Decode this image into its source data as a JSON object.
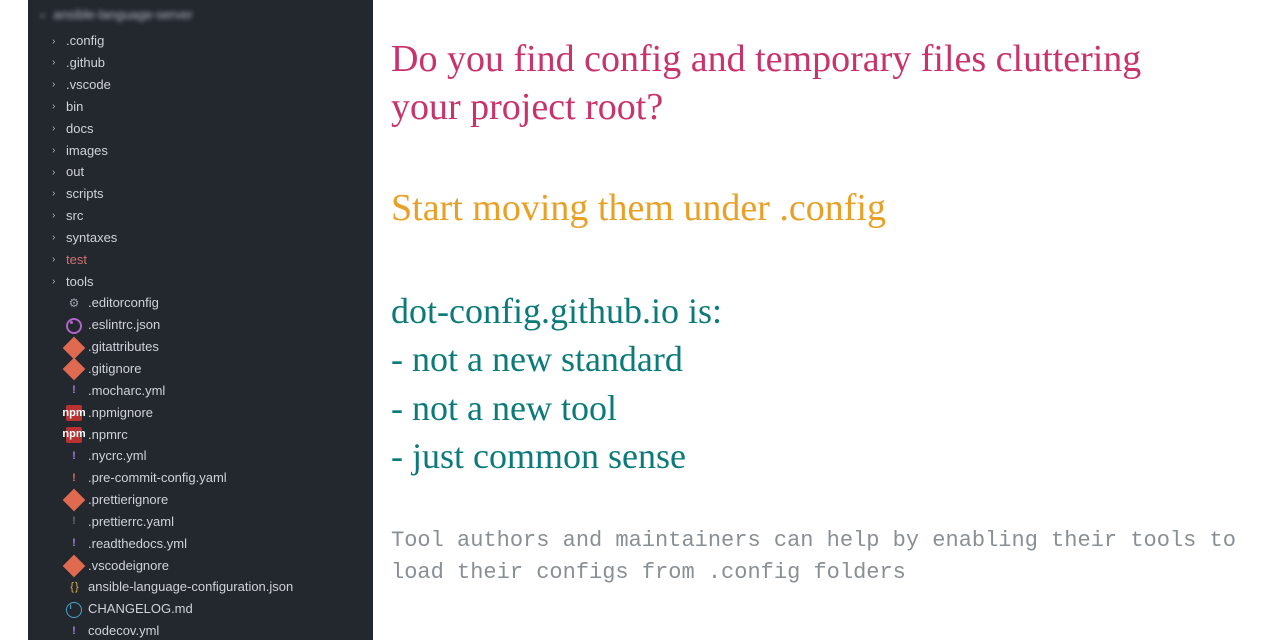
{
  "sidebar": {
    "root_label": "ansible-language-server",
    "folders": [
      {
        "name": ".config"
      },
      {
        "name": ".github"
      },
      {
        "name": ".vscode"
      },
      {
        "name": "bin"
      },
      {
        "name": "docs"
      },
      {
        "name": "images"
      },
      {
        "name": "out"
      },
      {
        "name": "scripts"
      },
      {
        "name": "src"
      },
      {
        "name": "syntaxes"
      },
      {
        "name": "test",
        "accent": true
      },
      {
        "name": "tools"
      }
    ],
    "files": [
      {
        "name": ".editorconfig",
        "icon": "ic-gear"
      },
      {
        "name": ".eslintrc.json",
        "icon": "ic-target"
      },
      {
        "name": ".gitattributes",
        "icon": "ic-diamond"
      },
      {
        "name": ".gitignore",
        "icon": "ic-diamond"
      },
      {
        "name": ".mocharc.yml",
        "icon": "ic-bang purple"
      },
      {
        "name": ".npmignore",
        "icon": "ic-npm"
      },
      {
        "name": ".npmrc",
        "icon": "ic-npm"
      },
      {
        "name": ".nycrc.yml",
        "icon": "ic-bang purple"
      },
      {
        "name": ".pre-commit-config.yaml",
        "icon": "ic-bang red"
      },
      {
        "name": ".prettierignore",
        "icon": "ic-diamond"
      },
      {
        "name": ".prettierrc.yaml",
        "icon": "ic-bang dark"
      },
      {
        "name": ".readthedocs.yml",
        "icon": "ic-bang purple"
      },
      {
        "name": ".vscodeignore",
        "icon": "ic-diamond"
      },
      {
        "name": "ansible-language-configuration.json",
        "icon": "ic-braces yellow"
      },
      {
        "name": "CHANGELOG.md",
        "icon": "ic-info"
      },
      {
        "name": "codecov.yml",
        "icon": "ic-bang purple"
      }
    ]
  },
  "content": {
    "headline": "Do you find config and temporary files cluttering your project root?",
    "subhead": "Start moving them under .config",
    "facts_lead": "dot-config.github.io is:",
    "facts_items": [
      "- not a new standard",
      "- not a new tool",
      "- just common sense"
    ],
    "footer": "Tool authors and maintainers can help by enabling their tools to load their configs from .config folders"
  }
}
